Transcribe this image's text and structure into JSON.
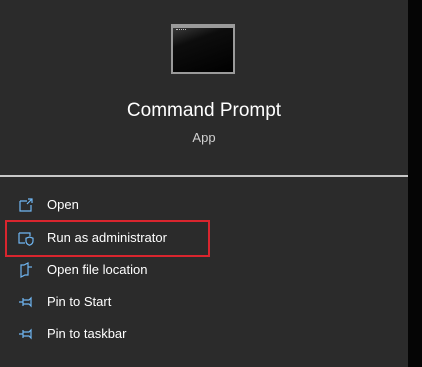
{
  "app": {
    "title": "Command Prompt",
    "subtitle": "App",
    "icon": "command-prompt-window-icon"
  },
  "menu": {
    "items": [
      {
        "label": "Open",
        "icon": "open-icon"
      },
      {
        "label": "Run as administrator",
        "icon": "shield-admin-icon"
      },
      {
        "label": "Open file location",
        "icon": "file-location-icon"
      },
      {
        "label": "Pin to Start",
        "icon": "pin-icon"
      },
      {
        "label": "Pin to taskbar",
        "icon": "pin-icon"
      }
    ]
  },
  "colors": {
    "panel_background": "#2b2b2b",
    "icon_accent": "#6fb6f2",
    "highlight_border": "#d9252e"
  }
}
